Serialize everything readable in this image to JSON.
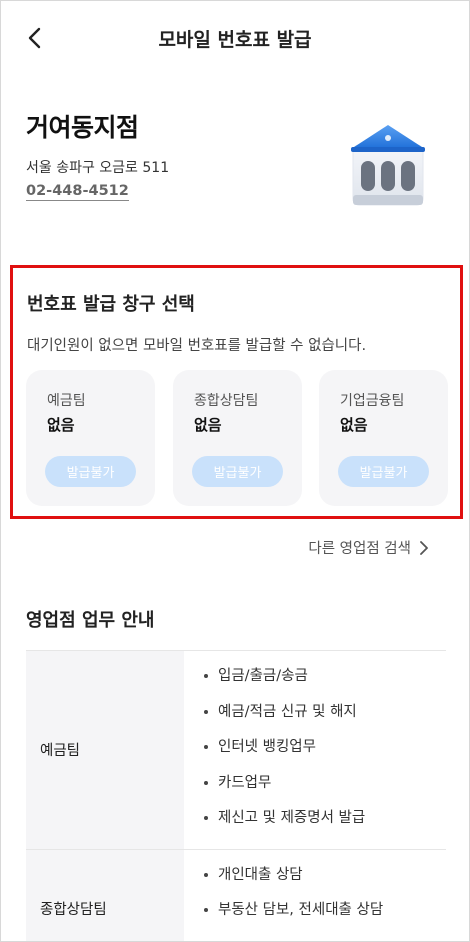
{
  "header": {
    "title": "모바일 번호표 발급"
  },
  "branch": {
    "name": "거여동지점",
    "address": "서울 송파구 오금로 511",
    "phone": "02-448-4512",
    "icon": "bank-building-icon"
  },
  "ticket_section": {
    "title": "번호표 발급 창구 선택",
    "description": "대기인원이 없으면 모바일 번호표를 발급할 수 없습니다.",
    "windows": [
      {
        "name": "예금팀",
        "status": "없음",
        "button": "발급불가"
      },
      {
        "name": "종합상담팀",
        "status": "없음",
        "button": "발급불가"
      },
      {
        "name": "기업금융팀",
        "status": "없음",
        "button": "발급불가"
      }
    ],
    "highlight_color": "#e01010",
    "disabled_button_color": "#c9e1fb"
  },
  "other_branch": {
    "label": "다른 영업점 검색"
  },
  "business_info": {
    "title": "영업점 업무 안내",
    "rows": [
      {
        "team": "예금팀",
        "tasks": [
          "입금/출금/송금",
          "예금/적금 신규 및 해지",
          "인터넷 뱅킹업무",
          "카드업무",
          "제신고 및 제증명서 발급"
        ]
      },
      {
        "team": "종합상담팀",
        "tasks": [
          "개인대출 상담",
          "부동산 담보, 전세대출 상담"
        ]
      }
    ]
  }
}
